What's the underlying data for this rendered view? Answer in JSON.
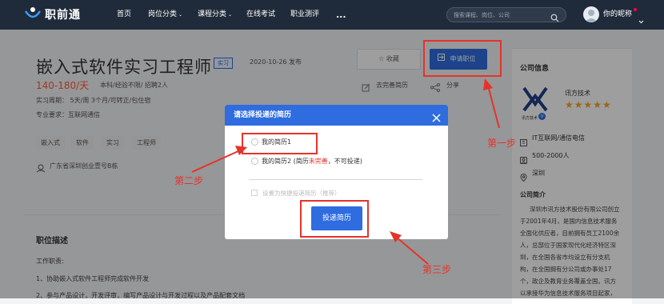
{
  "brand": {
    "name": "职前通"
  },
  "nav": {
    "items": [
      "首页",
      "岗位分类",
      "课程分类",
      "在线考试",
      "职业测评",
      "..."
    ],
    "search_placeholder": "搜索课程、岗位、公司",
    "username": "你的昵称"
  },
  "job": {
    "title": "嵌入式软件实习工程师",
    "type_badge": "实习",
    "date": "2020-10-26 发布",
    "salary": "140-180/天",
    "meta": "本科/经验不限/ 招聘2人",
    "period": "实习周期：  5天/周  3个月/可转正/包住宿",
    "major": "专业要求：互联网通信",
    "tags": [
      "嵌入式",
      "软件",
      "实习",
      "工程师"
    ],
    "location": "广东省深圳创业壹号B栋",
    "collect_label": "收藏",
    "apply_label": "申请职位",
    "improve_resume_label": "去完善简历",
    "share_label": "分享"
  },
  "description": {
    "heading": "职位描述",
    "duties_label": "工作职责:",
    "lines": [
      "1、协助嵌入式软件工程师完成软件开发",
      "2、参与产品设计，开发评审，编写产品设计与开发过程以及产品配套文档"
    ]
  },
  "company": {
    "section_title": "公司信息",
    "name": "讯方技术",
    "rating": 5,
    "stars": "★★★★★",
    "logo_caption": "讯方技术",
    "industry": "IT互联网/通信电信",
    "size": "500-2000人",
    "city": "深圳",
    "intro_title": "公司简介",
    "intro_lines": [
      "深圳市讯方技术股份有限公司创立",
      "于2001年4月，是国内信息技术服务",
      "全面化供应者，目前拥有员工2100余",
      "人，总部位于国家现代化经济特区深",
      "圳，在全国各省市均设立有分支机",
      "构，在全国拥有分公司或办事处17",
      "个，政企及教育业务覆盖全国。讯方",
      "以承接华为信息技术服务项目起家，"
    ]
  },
  "modal": {
    "title": "请选择投递的简历",
    "option1": "我的简历1",
    "option2_prefix": "我的简历2 (简历",
    "option2_highlight": "未完善",
    "option2_suffix": "，不可投递)",
    "default_checkbox": "设置为快捷投递简历（推荐）",
    "submit_label": "投递简历"
  },
  "annotations": {
    "step1": "第一步",
    "step2": "第二步",
    "step3": "第三步"
  },
  "colors": {
    "primary": "#2e6ce0",
    "salary": "#ff5a3c",
    "annotation": "#e5332a",
    "nav_bg": "#1f2b3a",
    "star": "#f5a623"
  }
}
